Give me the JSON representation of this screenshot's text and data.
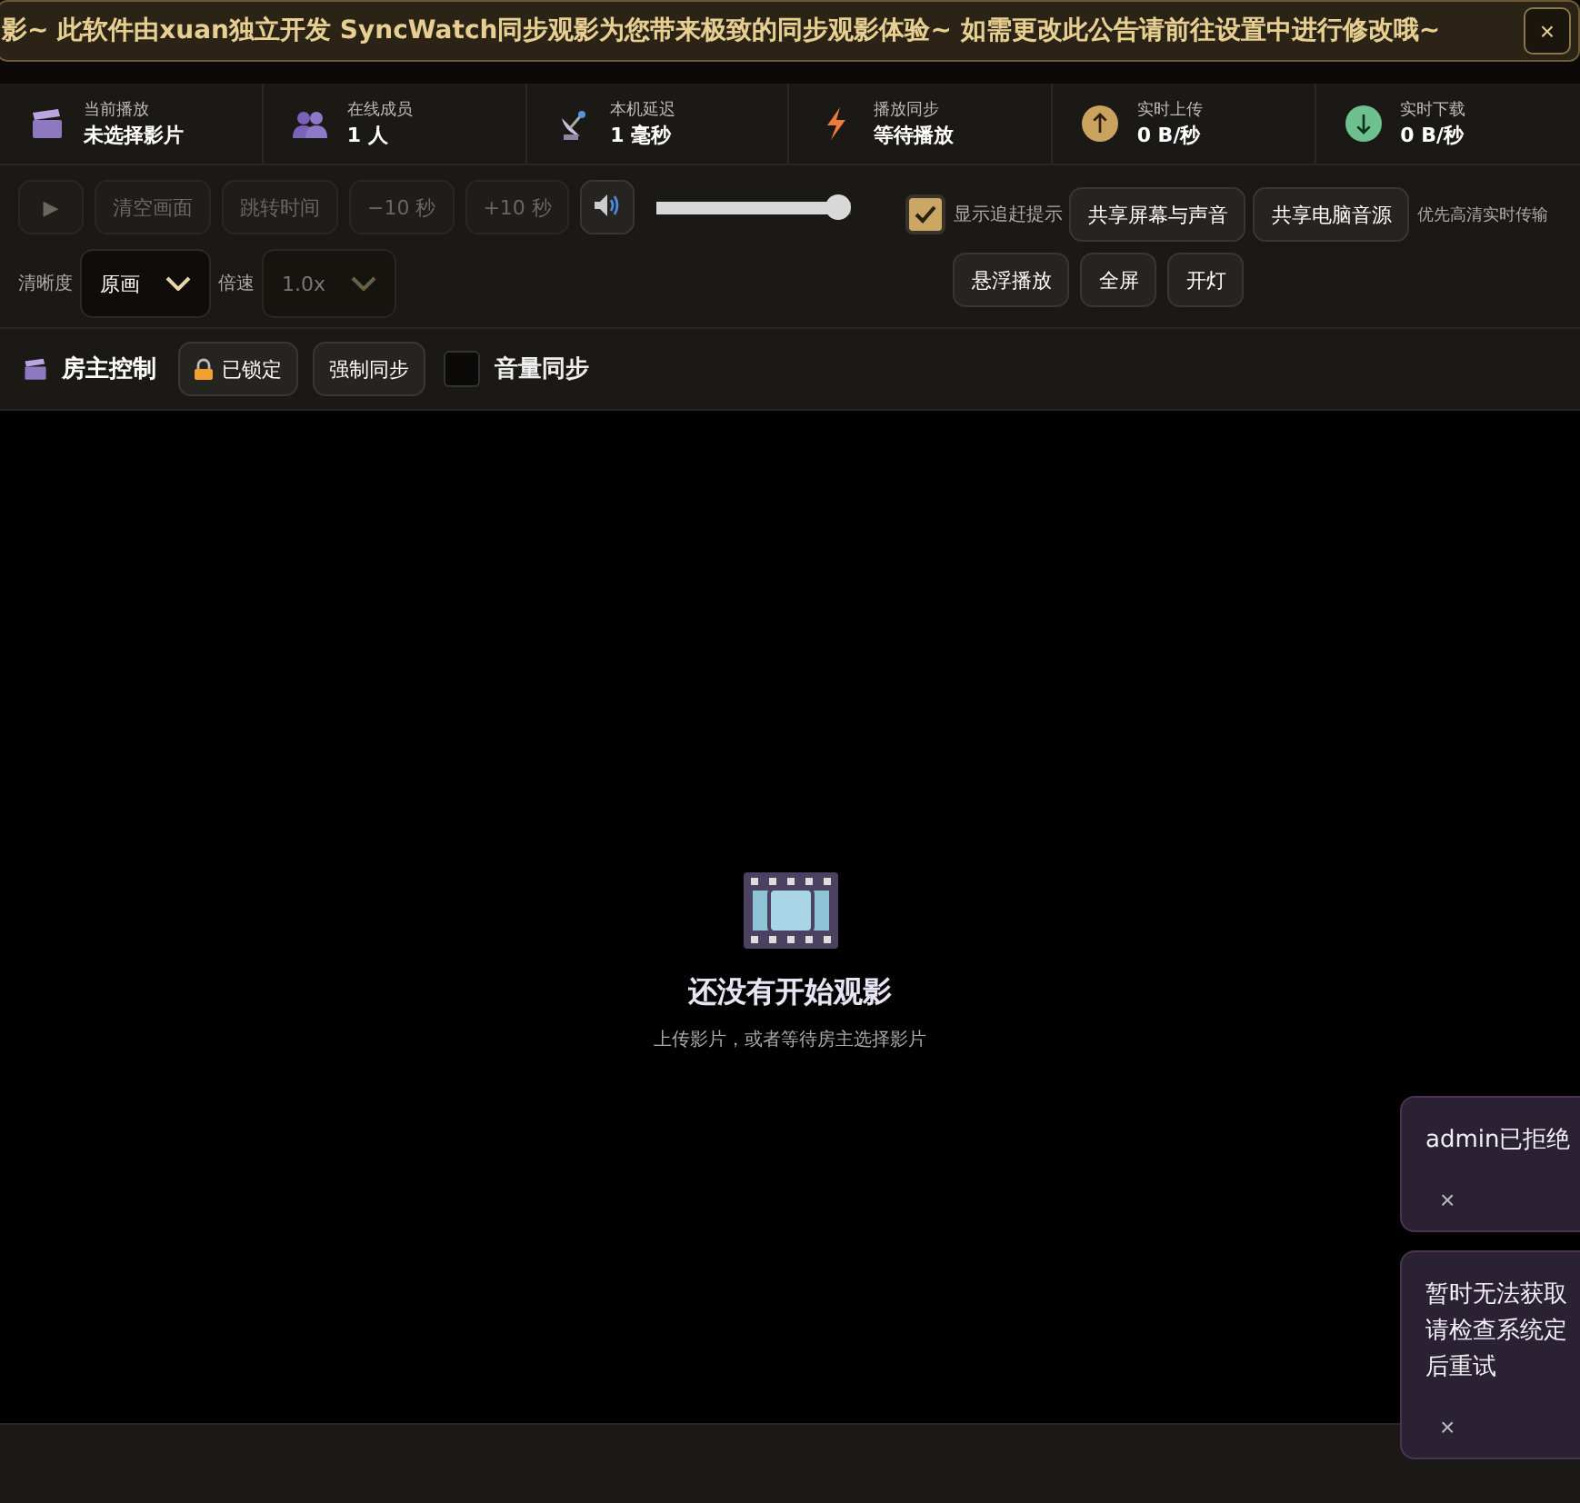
{
  "banner": {
    "text": "影~ 此软件由xuan独立开发 SyncWatch同步观影为您带来极致的同步观影体验~ 如需更改此公告请前往设置中进行修改哦~",
    "close": "×"
  },
  "stats": [
    {
      "kind": "clapper",
      "label": "当前播放",
      "value": "未选择影片"
    },
    {
      "kind": "people",
      "label": "在线成员",
      "value": "1 人"
    },
    {
      "kind": "satellite",
      "label": "本机延迟",
      "value": "1 毫秒"
    },
    {
      "kind": "bolt",
      "label": "播放同步",
      "value": "等待播放"
    },
    {
      "kind": "upload",
      "label": "实时上传",
      "value": "0 B/秒"
    },
    {
      "kind": "download",
      "label": "实时下载",
      "value": "0 B/秒"
    }
  ],
  "controls": {
    "play": {
      "label": "▶",
      "disabled": true
    },
    "buttons": [
      {
        "label": "清空画面",
        "disabled": true
      },
      {
        "label": "跳转时间",
        "disabled": true
      },
      {
        "label": "−10 秒",
        "disabled": true
      },
      {
        "label": "+10 秒",
        "disabled": true
      }
    ],
    "volume": {
      "level": 1
    },
    "quality": {
      "label": "清晰度",
      "value": "原画",
      "disabled": false
    },
    "speed": {
      "label": "倍速",
      "value": "1.0x",
      "disabled": true
    },
    "catchup": {
      "label": "显示追赶提示",
      "checked": true
    },
    "share_buttons": [
      "共享屏幕与声音",
      "共享电脑音源"
    ],
    "share_note": "优先高清实时传输",
    "view_buttons": [
      "悬浮播放",
      "全屏",
      "开灯"
    ]
  },
  "host": {
    "title": "房主控制",
    "lock": "已锁定",
    "force_sync": "强制同步",
    "volume_sync": {
      "label": "音量同步",
      "checked": false
    }
  },
  "stage": {
    "title": "还没有开始观影",
    "subtitle": "上传影片，或者等待房主选择影片"
  },
  "toasts": [
    {
      "lines": [
        "admin已拒绝"
      ],
      "close": "×"
    },
    {
      "lines": [
        "暂时无法获取",
        "请检查系统定",
        "后重试"
      ],
      "close": "×"
    }
  ]
}
